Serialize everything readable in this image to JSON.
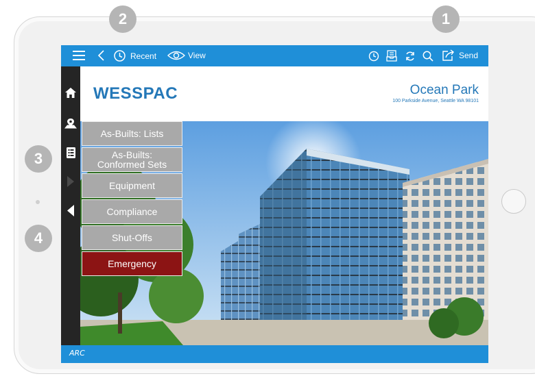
{
  "badges": [
    "2",
    "1",
    "3",
    "4"
  ],
  "topbar": {
    "recent_label": "Recent",
    "view_label": "View",
    "send_label": "Send"
  },
  "header": {
    "brand": "WESSPAC",
    "site_name": "Ocean Park",
    "site_address": "100 Parkside Avenue, Seattle WA 98101"
  },
  "menu": {
    "items": [
      {
        "label": "As-Builts: Lists"
      },
      {
        "label": "As-Builts:\nConformed Sets"
      },
      {
        "label": "Equipment"
      },
      {
        "label": "Compliance"
      },
      {
        "label": "Shut-Offs"
      },
      {
        "label": "Emergency"
      }
    ]
  },
  "footer": {
    "logo": "ARC"
  },
  "colors": {
    "accent_blue": "#1f8fd8",
    "brand_blue": "#2478b8",
    "sidebar": "#252525",
    "menu_gray": "#a9a9a9",
    "emergency_red": "#8c1414"
  },
  "icons": {
    "topbar_left": [
      "hamburger-menu-icon",
      "back-chevron-icon",
      "recent-clock-icon",
      "view-eye-icon"
    ],
    "topbar_right": [
      "history-icon",
      "inbox-icon",
      "refresh-icon",
      "search-icon",
      "send-share-icon"
    ],
    "sidebar": [
      "home-icon",
      "location-pin-icon",
      "document-list-icon",
      "play-forward-icon",
      "collapse-left-icon"
    ]
  }
}
